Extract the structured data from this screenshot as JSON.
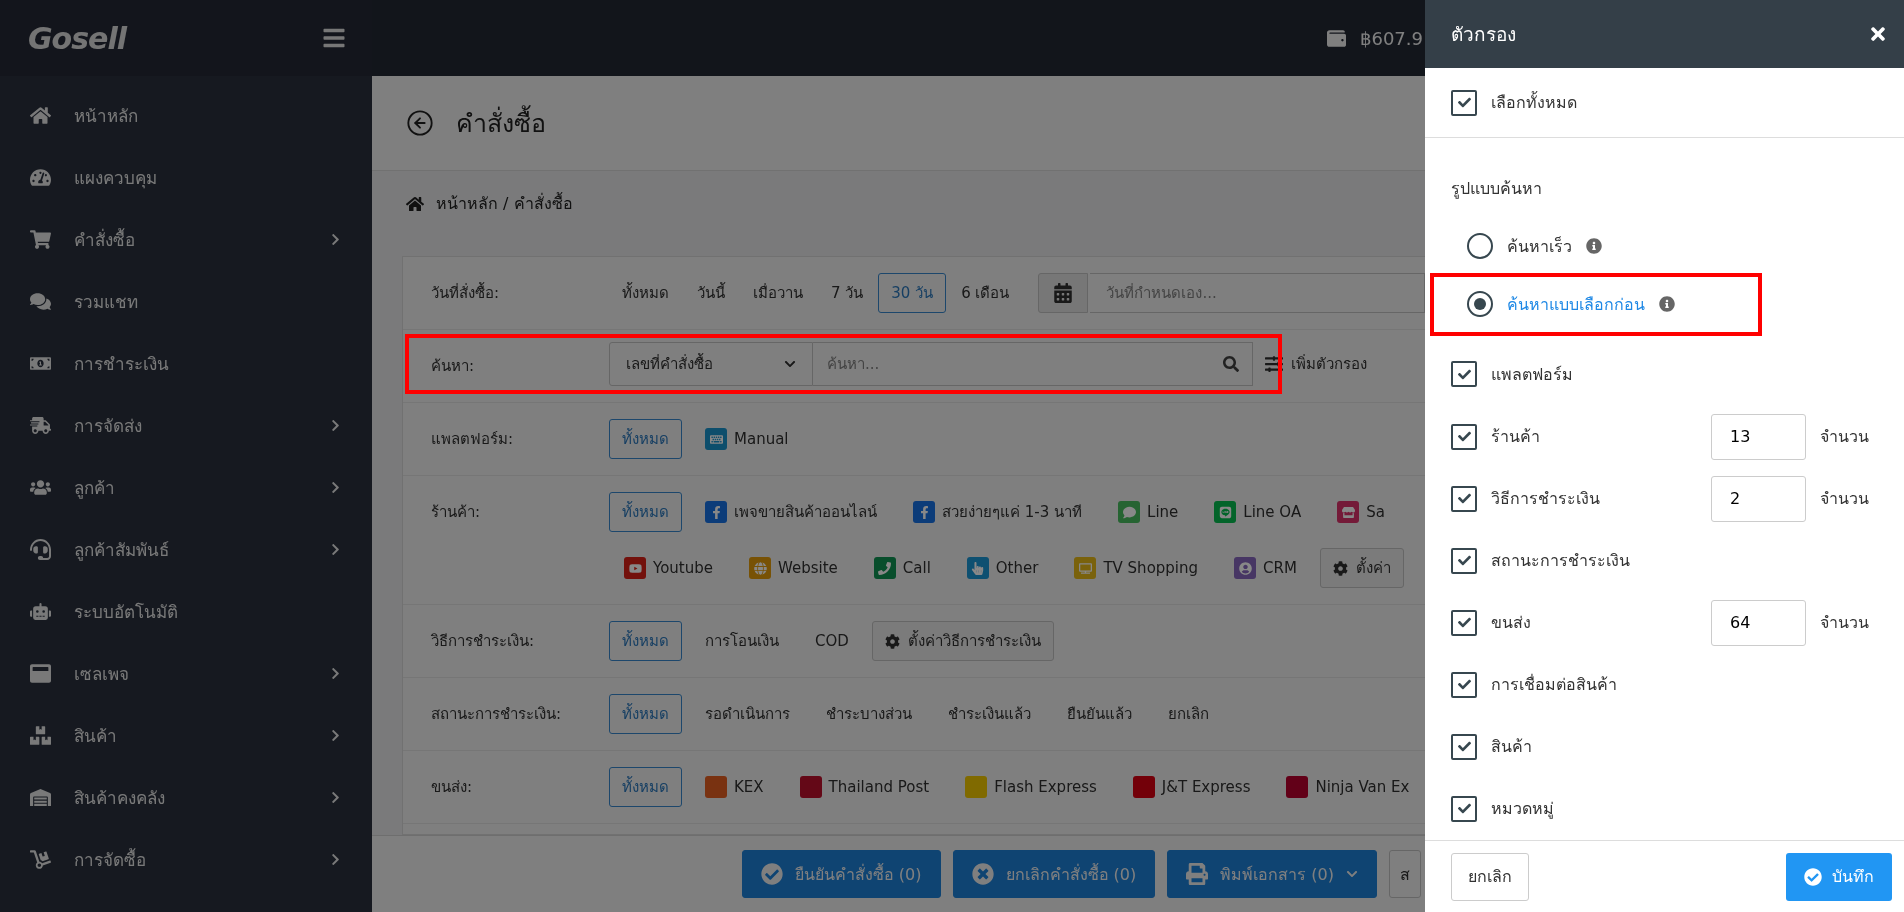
{
  "brand": {
    "logo": "Gosell",
    "balance": "฿607.9"
  },
  "sidebar": {
    "items": [
      {
        "label": "หน้าหลัก",
        "has_submenu": false
      },
      {
        "label": "แผงควบคุม",
        "has_submenu": false
      },
      {
        "label": "คำสั่งซื้อ",
        "has_submenu": true
      },
      {
        "label": "รวมแชท",
        "has_submenu": false
      },
      {
        "label": "การชำระเงิน",
        "has_submenu": false
      },
      {
        "label": "การจัดส่ง",
        "has_submenu": true
      },
      {
        "label": "ลูกค้า",
        "has_submenu": true
      },
      {
        "label": "ลูกค้าสัมพันธ์",
        "has_submenu": true
      },
      {
        "label": "ระบบอัตโนมัติ",
        "has_submenu": false
      },
      {
        "label": "เซลเพจ",
        "has_submenu": true
      },
      {
        "label": "สินค้า",
        "has_submenu": true
      },
      {
        "label": "สินค้าคงคลัง",
        "has_submenu": true
      },
      {
        "label": "การจัดซื้อ",
        "has_submenu": true
      }
    ]
  },
  "page": {
    "title": "คำสั่งซื้อ",
    "breadcrumb": "หน้าหลัก / คำสั่งซื้อ"
  },
  "date_filter": {
    "label": "วันที่สั่งซื้อ:",
    "options": [
      {
        "label": "ทั้งหมด",
        "selected": false
      },
      {
        "label": "วันนี้",
        "selected": false
      },
      {
        "label": "เมื่อวาน",
        "selected": false
      },
      {
        "label": "7 วัน",
        "selected": false
      },
      {
        "label": "30 วัน",
        "selected": true
      },
      {
        "label": "6 เดือน",
        "selected": false
      }
    ],
    "custom_placeholder": "วันที่กำหนดเอง..."
  },
  "search": {
    "label": "ค้นหา:",
    "field": "เลขที่คำสั่งซื้อ",
    "placeholder": "ค้นหา...",
    "add_filter": "เพิ่มตัวกรอง",
    "highlighted": true
  },
  "filter_rows": [
    {
      "label": "แพลตฟอร์ม:",
      "lines": [
        [
          {
            "label": "ทั้งหมด",
            "selected": true
          },
          {
            "label": "Manual",
            "selected": false,
            "color": "#0d4e6c"
          }
        ]
      ]
    },
    {
      "label": "ร้านค้า:",
      "lines": [
        [
          {
            "label": "ทั้งหมด",
            "selected": true
          },
          {
            "label": "เพจขายสินค้าออนไลน์",
            "selected": false,
            "color": "#0c3c79"
          },
          {
            "label": "สวยง่ายๆแค่ 1-3 นาที",
            "selected": false,
            "color": "#0c3c79"
          },
          {
            "label": "Line",
            "selected": false,
            "color": "#266432"
          },
          {
            "label": "Line OA",
            "selected": false,
            "color": "#03642a"
          },
          {
            "label": "Sa",
            "selected": false,
            "color": "#741a38"
          }
        ],
        [
          {
            "label": "Youtube",
            "selected": false,
            "color": "#73110c"
          },
          {
            "label": "Website",
            "selected": false,
            "color": "#785205"
          },
          {
            "label": "Call",
            "selected": false,
            "color": "#084e2c"
          },
          {
            "label": "Other",
            "selected": false,
            "color": "#0e5071"
          },
          {
            "label": "TV Shopping",
            "selected": false,
            "color": "#7a620c"
          },
          {
            "label": "CRM",
            "selected": false,
            "color": "#473664"
          }
        ]
      ],
      "settings": "ตั้งค่า"
    },
    {
      "label": "วิธีการชำระเงิน:",
      "lines": [
        [
          {
            "label": "ทั้งหมด",
            "selected": true
          },
          {
            "label": "การโอนเงิน",
            "selected": false
          },
          {
            "label": "COD",
            "selected": false
          }
        ]
      ],
      "settings": "ตั้งค่าวิธีการชำระเงิน"
    },
    {
      "label": "สถานะการชำระเงิน:",
      "lines": [
        [
          {
            "label": "ทั้งหมด",
            "selected": true
          },
          {
            "label": "รอดำเนินการ",
            "selected": false
          },
          {
            "label": "ชำระบางส่วน",
            "selected": false
          },
          {
            "label": "ชำระเงินแล้ว",
            "selected": false
          },
          {
            "label": "ยืนยันแล้ว",
            "selected": false
          },
          {
            "label": "ยกเลิก",
            "selected": false
          }
        ]
      ]
    },
    {
      "label": "ขนส่ง:",
      "lines": [
        [
          {
            "label": "ทั้งหมด",
            "selected": true
          },
          {
            "label": "KEX",
            "selected": false,
            "color": "#793211"
          },
          {
            "label": "Thailand Post",
            "selected": false,
            "color": "#640817"
          },
          {
            "label": "Flash Express",
            "selected": false,
            "color": "#806a00"
          },
          {
            "label": "J&T Express",
            "selected": false,
            "color": "#730009"
          },
          {
            "label": "Ninja Van Ex",
            "selected": false,
            "color": "#620018"
          }
        ]
      ]
    }
  ],
  "actions": [
    {
      "label": "ยืนยันคำสั่งซื้อ (0)",
      "kind": "confirm"
    },
    {
      "label": "ยกเลิกคำสั่งซื้อ (0)",
      "kind": "cancel"
    },
    {
      "label": "พิมพ์เอกสาร (0)",
      "kind": "print"
    },
    {
      "label": "ส",
      "kind": "outline"
    }
  ],
  "drawer": {
    "title": "ตัวกรอง",
    "select_all": {
      "label": "เลือกทั้งหมด",
      "checked": true
    },
    "section": "รูปแบบค้นหา",
    "modes": [
      {
        "label": "ค้นหาเร็ว",
        "selected": false,
        "highlighted": false
      },
      {
        "label": "ค้นหาแบบเลือกก่อน",
        "selected": true,
        "highlighted": true
      }
    ],
    "items": [
      {
        "label": "แพลตฟอร์ม",
        "checked": true
      },
      {
        "label": "ร้านค้า",
        "checked": true,
        "count": "13",
        "unit": "จำนวน"
      },
      {
        "label": "วิธีการชำระเงิน",
        "checked": true,
        "count": "2",
        "unit": "จำนวน"
      },
      {
        "label": "สถานะการชำระเงิน",
        "checked": true
      },
      {
        "label": "ขนส่ง",
        "checked": true,
        "count": "64",
        "unit": "จำนวน"
      },
      {
        "label": "การเชื่อมต่อสินค้า",
        "checked": true
      },
      {
        "label": "สินค้า",
        "checked": true
      },
      {
        "label": "หมวดหมู่",
        "checked": true
      }
    ],
    "cancel": "ยกเลิก",
    "save": "บันทึก"
  }
}
